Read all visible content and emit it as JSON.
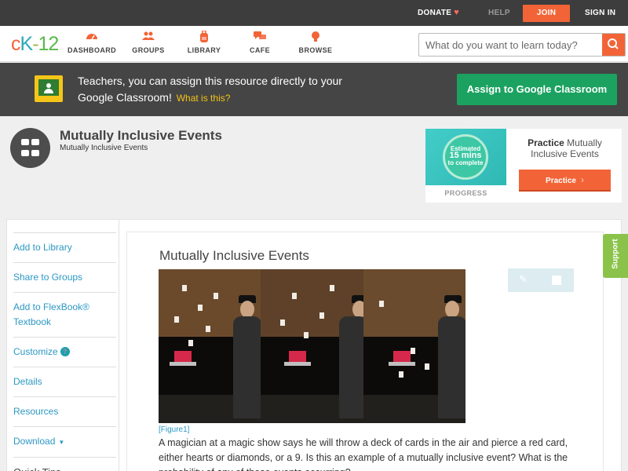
{
  "topbar": {
    "donate": "DONATE",
    "help": "HELP",
    "join": "JOIN",
    "signin": "SIGN IN",
    "heart_icon": "heart-icon"
  },
  "logo": {
    "c": "c",
    "k": "K",
    "dash": "-",
    "n": "12"
  },
  "nav": [
    {
      "label": "DASHBOARD",
      "icon": "speedometer-icon"
    },
    {
      "label": "GROUPS",
      "icon": "people-icon"
    },
    {
      "label": "LIBRARY",
      "icon": "backpack-icon"
    },
    {
      "label": "CAFE",
      "icon": "chat-bubbles-icon"
    },
    {
      "label": "BROWSE",
      "icon": "lightbulb-icon"
    }
  ],
  "search": {
    "placeholder": "What do you want to learn today?"
  },
  "banner": {
    "text": "Teachers, you can assign this resource directly to your Google Classroom!",
    "what": "What is this?",
    "assign": "Assign to Google Classroom"
  },
  "header": {
    "title": "Mutually Inclusive Events",
    "subtitle": "Mutually Inclusive Events"
  },
  "practice_card": {
    "est_line1": "Estimated",
    "est_line2": "15 mins",
    "est_line3": "to complete",
    "progress": "PROGRESS",
    "practice_bold": "Practice",
    "practice_rest": "Mutually Inclusive Events",
    "button": "Practice"
  },
  "sidebar": {
    "items": [
      "Add to Library",
      "Share to Groups",
      "Add to FlexBook® Textbook",
      "Customize",
      "Details",
      "Resources",
      "Download",
      "Quick Tips"
    ]
  },
  "content": {
    "title": "Mutually Inclusive Events",
    "caption": "[Figure1]",
    "text": "A magician at a magic show says he will throw a deck of cards in the air and pierce a red card, either hearts or diamonds, or a 9.  Is this an example of a mutually inclusive event?  What is the probability of any of these events occurring?"
  },
  "support": "Support",
  "colors": {
    "accent": "#f26437",
    "link": "#2c98c4",
    "classroom_green": "#1ba260",
    "support_green": "#8bc34a",
    "banner_bg": "#454545"
  }
}
